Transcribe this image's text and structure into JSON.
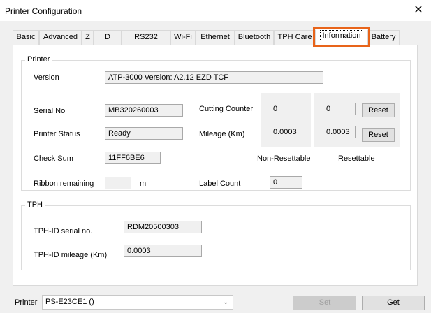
{
  "window": {
    "title": "Printer Configuration",
    "close_glyph": "✕"
  },
  "tabs": [
    {
      "label": "Basic"
    },
    {
      "label": "Advanced"
    },
    {
      "label": "Z"
    },
    {
      "label": "D"
    },
    {
      "label": "RS232"
    },
    {
      "label": "Wi-Fi"
    },
    {
      "label": "Ethernet"
    },
    {
      "label": "Bluetooth"
    },
    {
      "label": "TPH Care"
    },
    {
      "label": "Information",
      "active": true
    },
    {
      "label": "Battery"
    }
  ],
  "highlight_color": "#e8641a",
  "printer_group": {
    "title": "Printer",
    "version_label": "Version",
    "version_value": "ATP-3000 Version: A2.12 EZD TCF",
    "serial_label": "Serial No",
    "serial_value": "MB320260003",
    "status_label": "Printer Status",
    "status_value": "Ready",
    "checksum_label": "Check Sum",
    "checksum_value": "11FF6BE6",
    "ribbon_label": "Ribbon remaining",
    "ribbon_value": "",
    "ribbon_unit": "m",
    "cutting_label": "Cutting Counter",
    "cutting_nonreset": "0",
    "cutting_reset": "0",
    "mileage_label": "Mileage (Km)",
    "mileage_nonreset": "0.0003",
    "mileage_reset": "0.0003",
    "reset_label": "Reset",
    "nonresettable_label": "Non-Resettable",
    "resettable_label": "Resettable",
    "label_count_label": "Label Count",
    "label_count_value": "0"
  },
  "tph_group": {
    "title": "TPH",
    "serial_label": "TPH-ID serial no.",
    "serial_value": "RDM20500303",
    "mileage_label": "TPH-ID mileage (Km)",
    "mileage_value": "0.0003"
  },
  "footer": {
    "printer_label": "Printer",
    "printer_value": "PS-E23CE1 ()",
    "dropdown_icon": "chevron-down",
    "set_label": "Set",
    "get_label": "Get"
  }
}
